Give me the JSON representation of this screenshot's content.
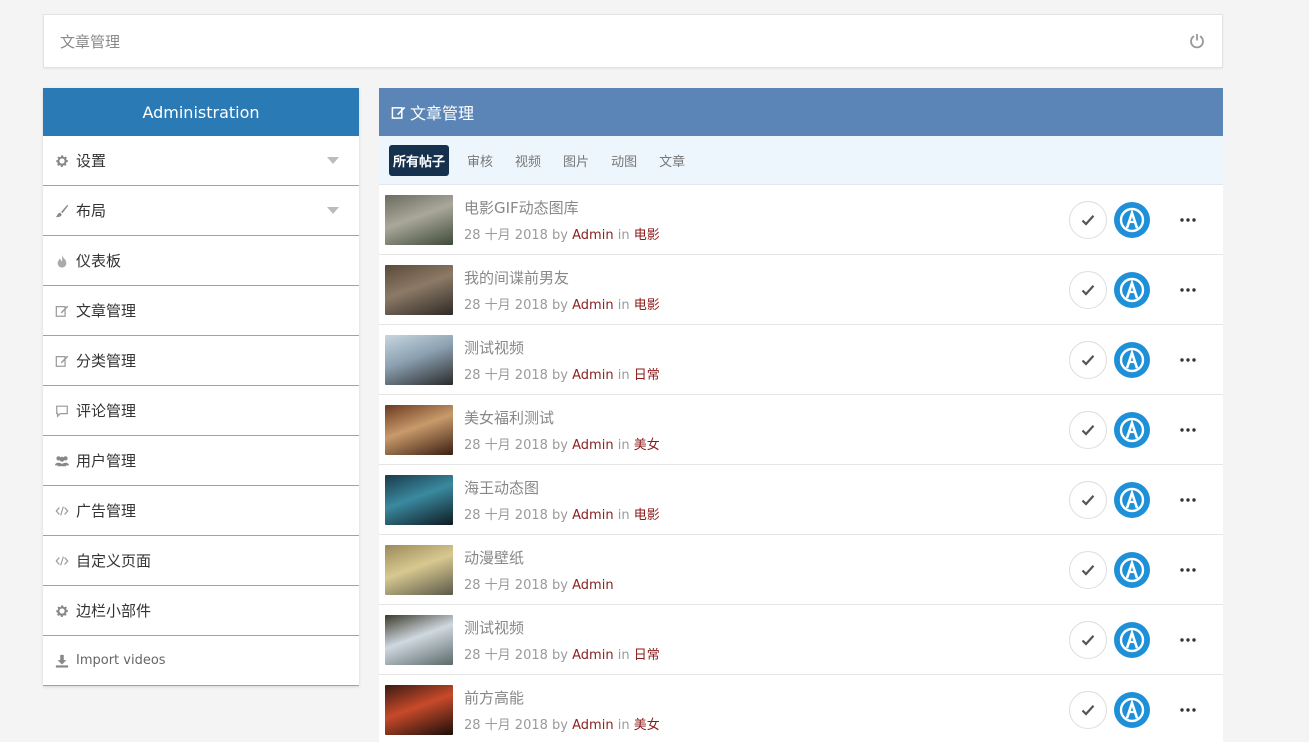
{
  "topbar": {
    "title": "文章管理",
    "power_icon": "power-icon"
  },
  "sidebar": {
    "header": "Administration",
    "items": [
      {
        "label": "设置",
        "icon": "gear-icon",
        "caret": true
      },
      {
        "label": "布局",
        "icon": "brush-icon",
        "caret": true
      },
      {
        "label": "仪表板",
        "icon": "fire-icon",
        "caret": false
      },
      {
        "label": "文章管理",
        "icon": "edit-icon",
        "caret": false
      },
      {
        "label": "分类管理",
        "icon": "edit-icon",
        "caret": false
      },
      {
        "label": "评论管理",
        "icon": "comment-icon",
        "caret": false
      },
      {
        "label": "用户管理",
        "icon": "users-icon",
        "caret": false
      },
      {
        "label": "广告管理",
        "icon": "code-icon",
        "caret": false
      },
      {
        "label": "自定义页面",
        "icon": "code-icon",
        "caret": false
      },
      {
        "label": "边栏小部件",
        "icon": "gear-icon",
        "caret": false
      },
      {
        "label": "Import videos",
        "icon": "download-icon",
        "caret": false
      }
    ]
  },
  "main": {
    "header": "文章管理",
    "tabs": [
      "所有帖子",
      "审核",
      "视频",
      "图片",
      "动图",
      "文章"
    ],
    "active_tab": "所有帖子",
    "by_label": "by",
    "in_label": "in",
    "posts": [
      {
        "title": "电影GIF动态图库",
        "date": "28 十月 2018",
        "author": "Admin",
        "category": "电影",
        "thumb_colors": [
          "#6b6b5e",
          "#a9a89a",
          "#3f4a3a"
        ]
      },
      {
        "title": "我的间谍前男友",
        "date": "28 十月 2018",
        "author": "Admin",
        "category": "电影",
        "thumb_colors": [
          "#5a4a3a",
          "#8c7a66",
          "#2e2a26"
        ]
      },
      {
        "title": "测试视频",
        "date": "28 十月 2018",
        "author": "Admin",
        "category": "日常",
        "thumb_colors": [
          "#c8d6e0",
          "#8aa0b0",
          "#2a2a2a"
        ]
      },
      {
        "title": "美女福利测试",
        "date": "28 十月 2018",
        "author": "Admin",
        "category": "美女",
        "thumb_colors": [
          "#6a3a22",
          "#c99a6a",
          "#3a1e12"
        ]
      },
      {
        "title": "海王动态图",
        "date": "28 十月 2018",
        "author": "Admin",
        "category": "电影",
        "thumb_colors": [
          "#1a3a4a",
          "#3a8aa0",
          "#0e1a22"
        ]
      },
      {
        "title": "动漫壁纸",
        "date": "28 十月 2018",
        "author": "Admin",
        "category": "",
        "thumb_colors": [
          "#9a8a5a",
          "#d8c890",
          "#5a5a4a"
        ]
      },
      {
        "title": "测试视频",
        "date": "28 十月 2018",
        "author": "Admin",
        "category": "日常",
        "thumb_colors": [
          "#3a3a2a",
          "#d0d8e0",
          "#5a6a6a"
        ]
      },
      {
        "title": "前方高能",
        "date": "28 十月 2018",
        "author": "Admin",
        "category": "美女",
        "thumb_colors": [
          "#3a1a12",
          "#c84a2a",
          "#1a0e0a"
        ]
      }
    ]
  }
}
